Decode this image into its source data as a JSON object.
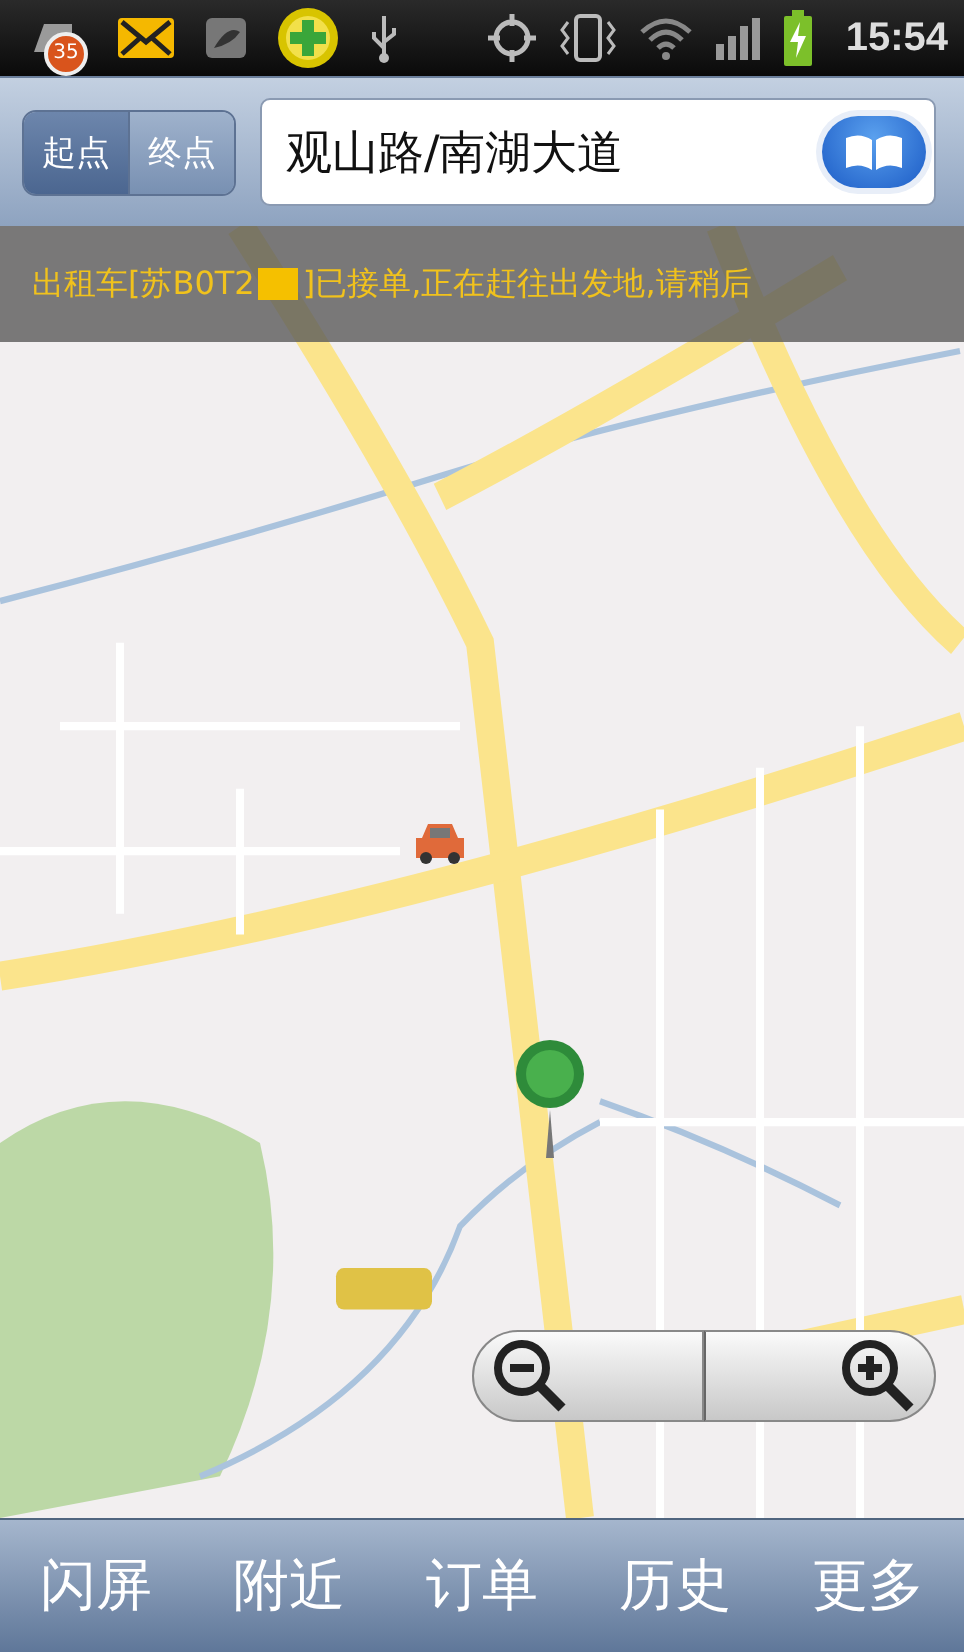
{
  "status_bar": {
    "badge": "35",
    "time": "15:54"
  },
  "route": {
    "segments": [
      {
        "label": "起点",
        "selected": true
      },
      {
        "label": "终点",
        "selected": false
      }
    ],
    "value": "观山路/南湖大道"
  },
  "banner": {
    "text_before": "出租车[苏B0T2",
    "redacted": true,
    "text_after": "]已接单,正在赶往出发地,请稍后"
  },
  "map": {
    "zoom_out_disabled": false,
    "zoom_in_disabled": false
  },
  "bottom_nav": [
    {
      "label": "闪屏"
    },
    {
      "label": "附近"
    },
    {
      "label": "订单"
    },
    {
      "label": "历史"
    },
    {
      "label": "更多"
    }
  ]
}
